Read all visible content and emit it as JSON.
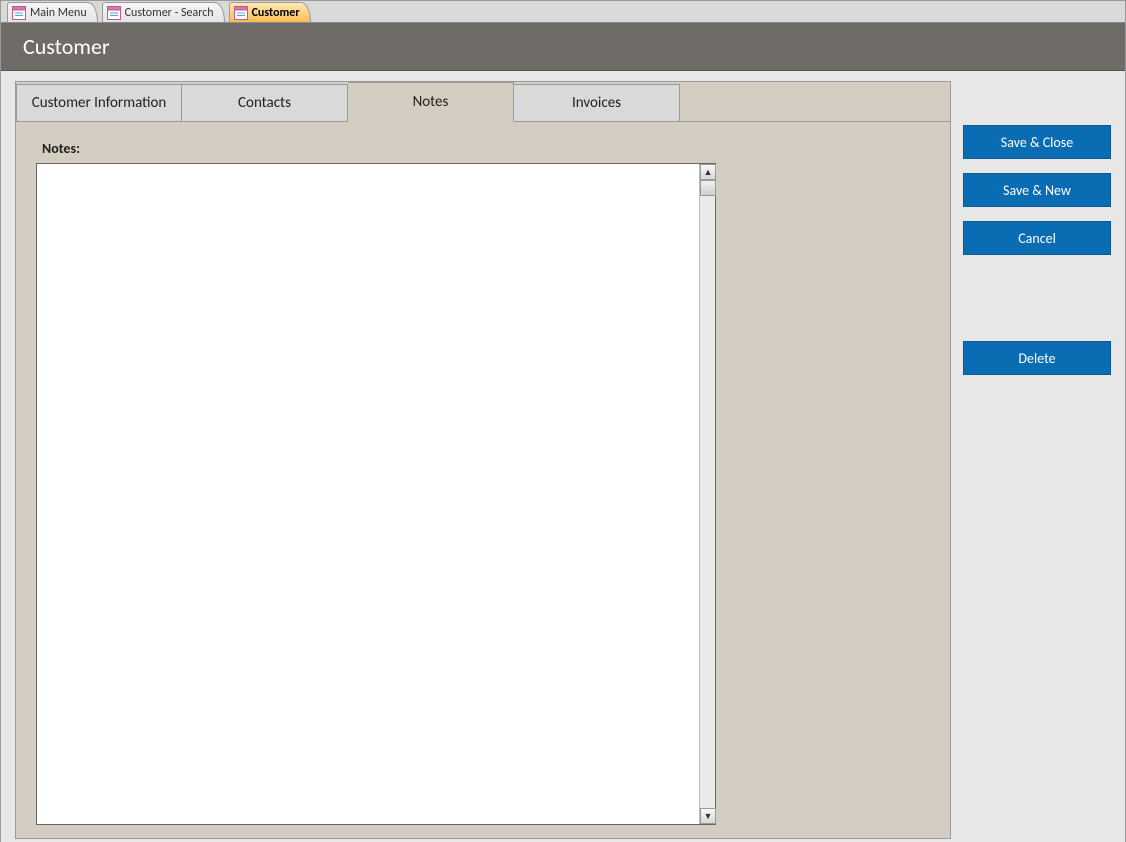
{
  "doc_tabs": [
    {
      "label": "Main Menu",
      "active": false
    },
    {
      "label": "Customer - Search",
      "active": false
    },
    {
      "label": "Customer",
      "active": true
    }
  ],
  "header": {
    "title": "Customer"
  },
  "tabs": [
    {
      "label": "Customer Information",
      "active": false
    },
    {
      "label": "Contacts",
      "active": false
    },
    {
      "label": "Notes",
      "active": true
    },
    {
      "label": "Invoices",
      "active": false
    }
  ],
  "notes": {
    "label": "Notes:",
    "value": ""
  },
  "actions": {
    "save_close": "Save & Close",
    "save_new": "Save & New",
    "cancel": "Cancel",
    "delete": "Delete"
  }
}
